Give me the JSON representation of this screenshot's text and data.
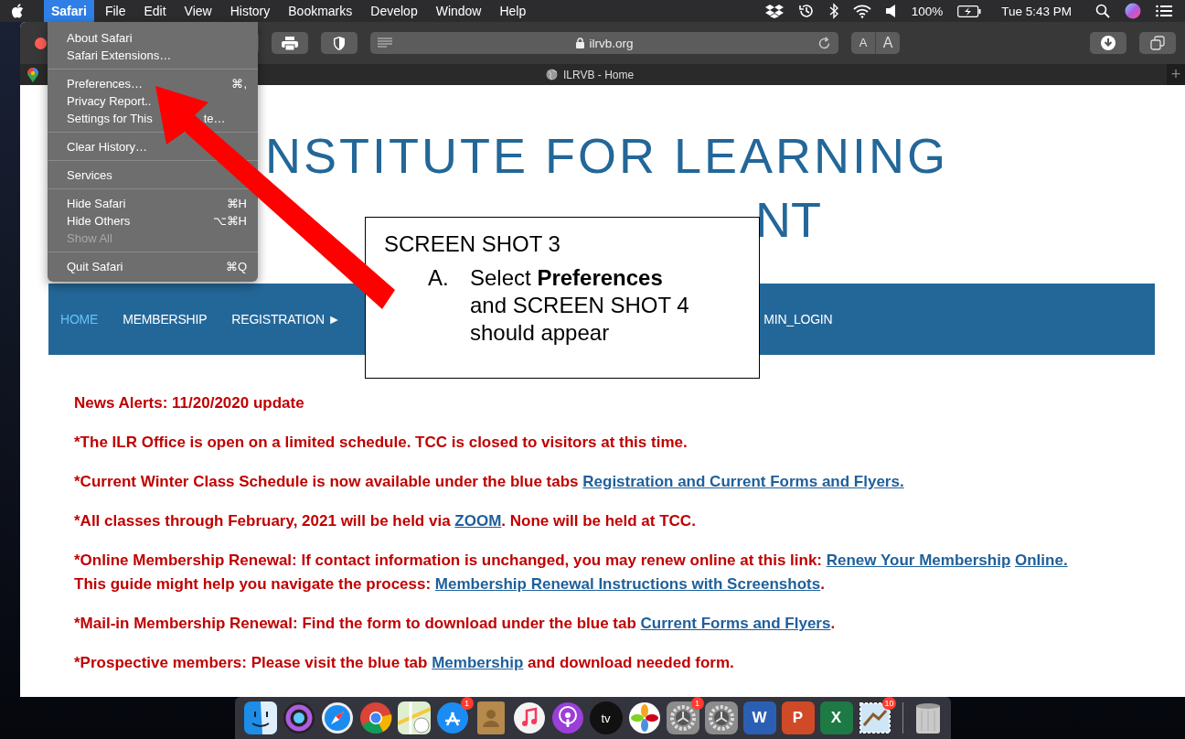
{
  "menu_bar": {
    "items": [
      {
        "label": "Safari",
        "selected": true
      },
      {
        "label": "File",
        "selected": false
      },
      {
        "label": "Edit",
        "selected": false
      },
      {
        "label": "View",
        "selected": false
      },
      {
        "label": "History",
        "selected": false
      },
      {
        "label": "Bookmarks",
        "selected": false
      },
      {
        "label": "Develop",
        "selected": false
      },
      {
        "label": "Window",
        "selected": false
      },
      {
        "label": "Help",
        "selected": false
      }
    ],
    "battery": "100%",
    "clock": "Tue 5:43 PM"
  },
  "toolbar": {
    "url": "ilrvb.org",
    "text_size_buttons": [
      "A",
      "A"
    ]
  },
  "tab": {
    "title": "ILRVB - Home",
    "new_tab": "+"
  },
  "app_menu": {
    "groups": [
      [
        {
          "label": "About Safari",
          "disabled": false
        },
        {
          "label": "Safari Extensions…",
          "disabled": false
        }
      ],
      [
        {
          "label": "Preferences…",
          "shortcut": "⌘,",
          "disabled": false
        },
        {
          "label": "Privacy Report..",
          "disabled": false
        },
        {
          "label": "Settings for This",
          "tail": "te…",
          "disabled": false
        }
      ],
      [
        {
          "label": "Clear History…",
          "disabled": false
        }
      ],
      [
        {
          "label": "Services",
          "disabled": false
        }
      ],
      [
        {
          "label": "Hide Safari",
          "shortcut": "⌘H",
          "disabled": false
        },
        {
          "label": "Hide Others",
          "shortcut": "⌥⌘H",
          "disabled": false
        },
        {
          "label": "Show All",
          "disabled": true
        }
      ],
      [
        {
          "label": "Quit Safari",
          "shortcut": "⌘Q",
          "disabled": false
        }
      ]
    ]
  },
  "site": {
    "title_lines": [
      "NSTITUTE FOR LEARNING",
      "NT"
    ],
    "nav": [
      {
        "label": "HOME",
        "selected": true
      },
      {
        "label": "MEMBERSHIP",
        "selected": false
      },
      {
        "label": "REGISTRATION ►",
        "selected": false
      },
      {
        "label": "MIN_LOGIN",
        "selected": false
      }
    ],
    "news": [
      {
        "segments": [
          {
            "kind": "text",
            "text": "News Alerts:  11/20/2020 update"
          }
        ]
      },
      {
        "segments": [
          {
            "kind": "text",
            "text": "*The ILR Office is open on a limited schedule.  TCC is closed to visitors at this time."
          }
        ]
      },
      {
        "segments": [
          {
            "kind": "text",
            "text": "*Current Winter Class Schedule is now available under the blue tabs "
          },
          {
            "kind": "link",
            "text": "Registration and Current Forms and Flyers."
          }
        ]
      },
      {
        "segments": [
          {
            "kind": "text",
            "text": "*All classes through February, 2021 will be held via "
          },
          {
            "kind": "link",
            "text": "ZOOM"
          },
          {
            "kind": "text",
            "text": ".  None will be held at TCC."
          }
        ]
      },
      {
        "segments": [
          {
            "kind": "text",
            "text": "*Online Membership Renewal:  If contact information is unchanged, you may renew online at this link:  "
          },
          {
            "kind": "link",
            "text": "Renew Your Membership"
          },
          {
            "kind": "link",
            "text": "Online."
          },
          {
            "kind": "text",
            "text": "   This guide might help you navigate the process:  "
          },
          {
            "kind": "link",
            "text": "Membership Renewal Instructions with Screenshots"
          },
          {
            "kind": "text",
            "text": "."
          }
        ]
      },
      {
        "segments": [
          {
            "kind": "text",
            "text": "*Mail-in Membership Renewal:  Find the form to download under the blue tab "
          },
          {
            "kind": "link",
            "text": "Current Forms and Flyers"
          },
          {
            "kind": "text",
            "text": "."
          }
        ]
      },
      {
        "segments": [
          {
            "kind": "text",
            "text": "*Prospective members:  Please visit the blue tab "
          },
          {
            "kind": "link",
            "text": "Membership"
          },
          {
            "kind": "text",
            "text": " and download needed form."
          }
        ]
      }
    ]
  },
  "callout": {
    "heading": "SCREEN SHOT 3",
    "steps": [
      {
        "marker": "A.",
        "text": "Select **Preferences** and SCREEN SHOT 4 should appear"
      }
    ]
  },
  "dock": {
    "items": [
      {
        "kind": "finder"
      },
      {
        "kind": "siri"
      },
      {
        "kind": "safari"
      },
      {
        "kind": "chrome"
      },
      {
        "kind": "maps"
      },
      {
        "kind": "appstore",
        "badge": "1"
      },
      {
        "kind": "contacts"
      },
      {
        "kind": "music"
      },
      {
        "kind": "podcasts"
      },
      {
        "kind": "tv",
        "glyph": "tv"
      },
      {
        "kind": "photos"
      },
      {
        "kind": "settings",
        "badge": "1"
      },
      {
        "kind": "settings"
      },
      {
        "kind": "office",
        "glyph": "W",
        "color": "#2b5fb4"
      },
      {
        "kind": "office",
        "glyph": "P",
        "color": "#d04a28"
      },
      {
        "kind": "office",
        "glyph": "X",
        "color": "#1e7a45"
      },
      {
        "kind": "mail",
        "badge": "10"
      },
      {
        "kind": "trash"
      }
    ]
  }
}
